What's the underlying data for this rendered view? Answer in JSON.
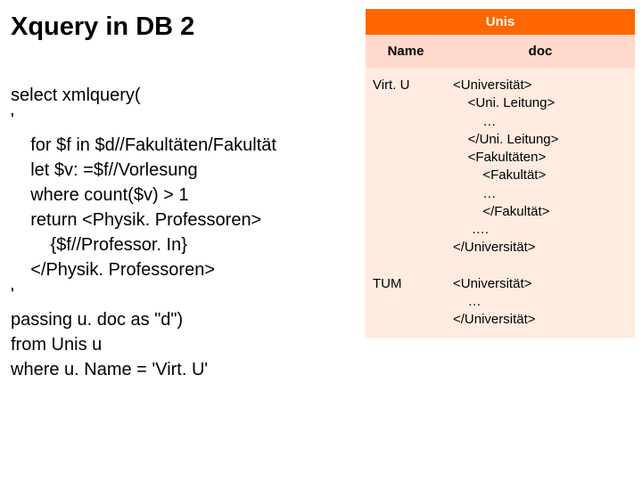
{
  "title": "Xquery in DB 2",
  "code": {
    "l1": "select xmlquery(",
    "l2": "'",
    "l3": "    for $f in $d//Fakultäten/Fakultät",
    "l4": "    let $v: =$f//Vorlesung",
    "l5": "    where count($v) > 1",
    "l6": "    return <Physik. Professoren>",
    "l7": "        {$f//Professor. In}",
    "l8": "    </Physik. Professoren>",
    "l9": "'",
    "l10": "passing u. doc as \"d\")",
    "l11": "from Unis u",
    "l12": "where u. Name = 'Virt. U'"
  },
  "table": {
    "title": "Unis",
    "headers": {
      "name": "Name",
      "doc": "doc"
    },
    "rows": [
      {
        "name": "Virt. U",
        "doc": "<Universität>\n    <Uni. Leitung>\n        …\n    </Uni. Leitung>\n    <Fakultäten>\n        <Fakultät>\n        …\n        </Fakultät>\n     ….\n</Universität>"
      },
      {
        "name": "TUM",
        "doc": "<Universität>\n    …\n</Universität>"
      }
    ]
  }
}
